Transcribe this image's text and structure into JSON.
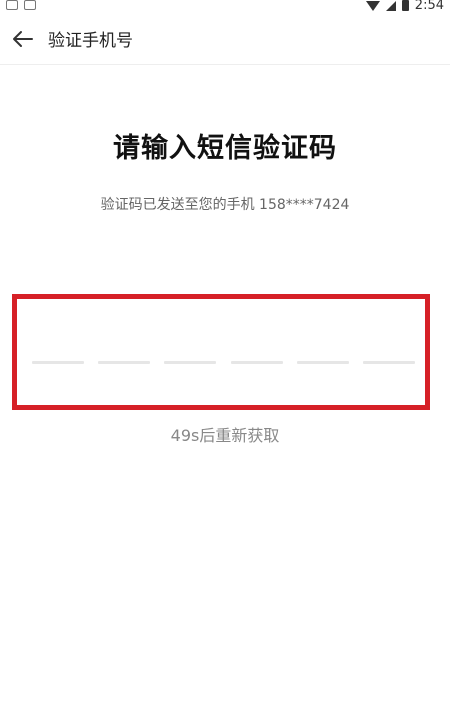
{
  "status_bar": {
    "time": "2:54",
    "icons": [
      "image-icon",
      "download-icon",
      "wifi-icon",
      "signal-icon",
      "battery-icon"
    ]
  },
  "header": {
    "back_icon": "arrow-left-icon",
    "title": "验证手机号"
  },
  "main": {
    "title": "请输入短信验证码",
    "subtitle": "验证码已发送至您的手机 158****7424",
    "code_slots": [
      "",
      "",
      "",
      "",
      "",
      ""
    ],
    "resend_text": "49s后重新获取"
  },
  "colors": {
    "highlight_border": "#d62027",
    "slot_line": "#e6e6e6",
    "muted_text": "#888888"
  }
}
